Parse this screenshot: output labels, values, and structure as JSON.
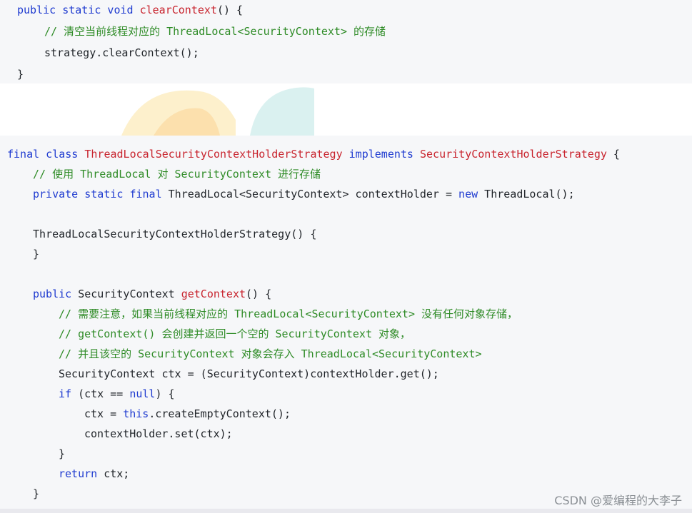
{
  "code_block_1": {
    "lines": [
      {
        "indent": 24,
        "tokens": [
          {
            "c": "kw",
            "t": "public static void "
          },
          {
            "c": "fn",
            "t": "clearContext"
          },
          {
            "c": "tx",
            "t": "() {"
          }
        ]
      },
      {
        "indent": 62,
        "tokens": [
          {
            "c": "cm",
            "t": "// 清空当前线程对应的 ThreadLocal<SecurityContext> 的存储"
          }
        ]
      },
      {
        "indent": 62,
        "tokens": [
          {
            "c": "tx",
            "t": "strategy.clearContext();"
          }
        ]
      },
      {
        "indent": 24,
        "tokens": [
          {
            "c": "tx",
            "t": "}"
          }
        ]
      }
    ]
  },
  "code_block_2": {
    "lines": [
      {
        "indent": 10,
        "tokens": [
          {
            "c": "kw",
            "t": "final class "
          },
          {
            "c": "fn",
            "t": "ThreadLocalSecurityContextHolderStrategy "
          },
          {
            "c": "kw",
            "t": "implements "
          },
          {
            "c": "fn",
            "t": "SecurityContextHolderStrategy "
          },
          {
            "c": "tx",
            "t": "{"
          }
        ]
      },
      {
        "indent": 46,
        "tokens": [
          {
            "c": "cm",
            "t": "// 使用 ThreadLocal 对 SecurityContext 进行存储"
          }
        ]
      },
      {
        "indent": 46,
        "tokens": [
          {
            "c": "kw",
            "t": "private static final "
          },
          {
            "c": "tx",
            "t": "ThreadLocal<SecurityContext> contextHolder = "
          },
          {
            "c": "kw",
            "t": "new "
          },
          {
            "c": "tx",
            "t": "ThreadLocal();"
          }
        ]
      },
      {
        "indent": 46,
        "tokens": []
      },
      {
        "indent": 46,
        "tokens": [
          {
            "c": "tx",
            "t": "ThreadLocalSecurityContextHolderStrategy() {"
          }
        ]
      },
      {
        "indent": 46,
        "tokens": [
          {
            "c": "tx",
            "t": "}"
          }
        ]
      },
      {
        "indent": 46,
        "tokens": []
      },
      {
        "indent": 46,
        "tokens": [
          {
            "c": "kw",
            "t": "public "
          },
          {
            "c": "tx",
            "t": "SecurityContext "
          },
          {
            "c": "fn",
            "t": "getContext"
          },
          {
            "c": "tx",
            "t": "() {"
          }
        ]
      },
      {
        "indent": 82,
        "tokens": [
          {
            "c": "cm",
            "t": "// 需要注意，如果当前线程对应的 ThreadLocal<SecurityContext> 没有任何对象存储，"
          }
        ]
      },
      {
        "indent": 82,
        "tokens": [
          {
            "c": "cm",
            "t": "// getContext() 会创建并返回一个空的 SecurityContext 对象，"
          }
        ]
      },
      {
        "indent": 82,
        "tokens": [
          {
            "c": "cm",
            "t": "// 并且该空的 SecurityContext 对象会存入 ThreadLocal<SecurityContext>"
          }
        ]
      },
      {
        "indent": 82,
        "tokens": [
          {
            "c": "tx",
            "t": "SecurityContext ctx = (SecurityContext)contextHolder.get();"
          }
        ]
      },
      {
        "indent": 82,
        "tokens": [
          {
            "c": "kw",
            "t": "if "
          },
          {
            "c": "tx",
            "t": "(ctx == "
          },
          {
            "c": "kw",
            "t": "null"
          },
          {
            "c": "tx",
            "t": ") {"
          }
        ]
      },
      {
        "indent": 118,
        "tokens": [
          {
            "c": "tx",
            "t": "ctx = "
          },
          {
            "c": "kw",
            "t": "this"
          },
          {
            "c": "tx",
            "t": ".createEmptyContext();"
          }
        ]
      },
      {
        "indent": 118,
        "tokens": [
          {
            "c": "tx",
            "t": "contextHolder.set(ctx);"
          }
        ]
      },
      {
        "indent": 82,
        "tokens": [
          {
            "c": "tx",
            "t": "}"
          }
        ]
      },
      {
        "indent": 82,
        "tokens": [
          {
            "c": "kw",
            "t": "return "
          },
          {
            "c": "tx",
            "t": "ctx;"
          }
        ]
      },
      {
        "indent": 46,
        "tokens": [
          {
            "c": "tx",
            "t": "}"
          }
        ]
      }
    ]
  },
  "watermark": {
    "text": "CSDN @爱编程的大李子"
  },
  "colors": {
    "keyword": "#1f3bd0",
    "function_name": "#c8232d",
    "comment": "#2e8b26",
    "text": "#1f2328",
    "code_background": "#f6f7f9"
  }
}
